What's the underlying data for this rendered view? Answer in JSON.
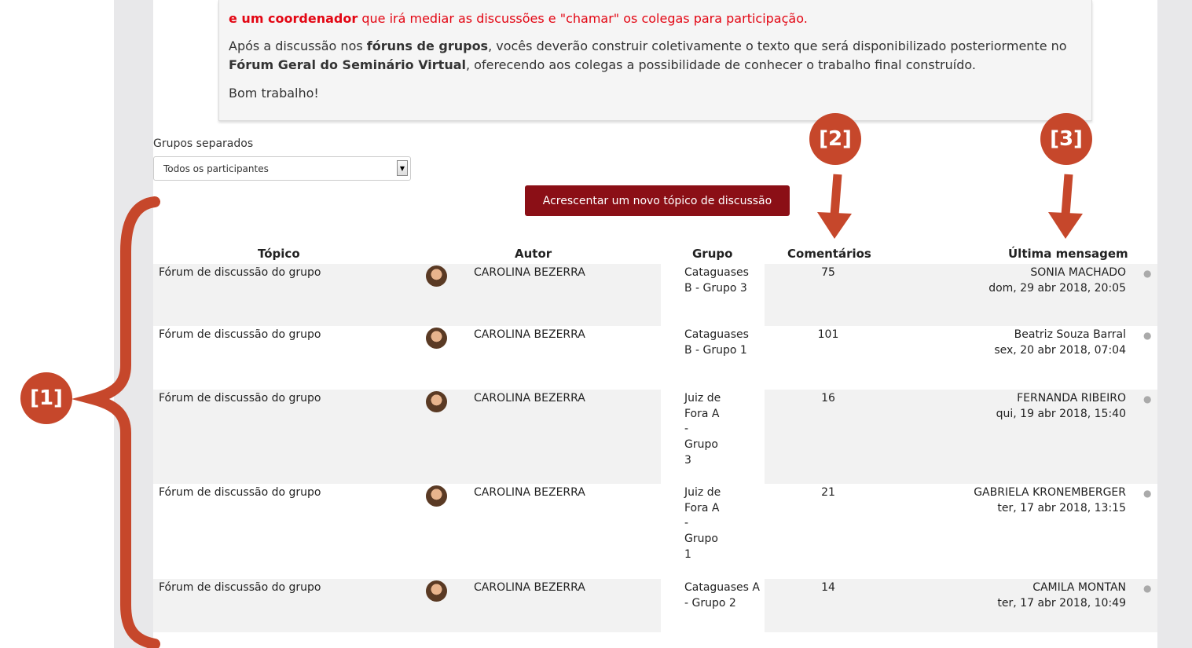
{
  "intro": {
    "line1_bold": "e um coordenador",
    "line1_rest": " que irá mediar as discussões e \"chamar\" os colegas para participação.",
    "p2_part1": "Após a discussão nos ",
    "p2_bold1": "fóruns de grupos",
    "p2_part2": ", vocês deverão construir coletivamente o texto que será disponibilizado posteriormente no ",
    "p2_bold2": "Fórum Geral do Seminário Virtual",
    "p2_part3": ", oferecendo aos colegas a possibilidade de conhecer o trabalho final construído.",
    "p3": "Bom trabalho!"
  },
  "group_filter": {
    "label": "Grupos separados",
    "selected": "Todos os participantes"
  },
  "add_topic_label": "Acrescentar um novo tópico de discussão",
  "table": {
    "headers": {
      "topic": "Tópico",
      "author": "Autor",
      "group": "Grupo",
      "comments": "Comentários",
      "last": "Última mensagem"
    },
    "rows": [
      {
        "topic": "Fórum de discussão do grupo",
        "author": "CAROLINA BEZERRA",
        "group": "Cataguases B - Grupo 3",
        "comments": "75",
        "last_user": "SONIA MACHADO",
        "last_date": "dom, 29 abr 2018, 20:05"
      },
      {
        "topic": "Fórum de discussão do grupo",
        "author": "CAROLINA BEZERRA",
        "group": "Cataguases B - Grupo 1",
        "comments": "101",
        "last_user": "Beatriz Souza Barral",
        "last_date": "sex, 20 abr 2018, 07:04"
      },
      {
        "topic": "Fórum de discussão do grupo",
        "author": "CAROLINA BEZERRA",
        "group": "Juiz de Fora A - Grupo 3",
        "comments": "16",
        "last_user": "FERNANDA RIBEIRO",
        "last_date": "qui, 19 abr 2018, 15:40"
      },
      {
        "topic": "Fórum de discussão do grupo",
        "author": "CAROLINA BEZERRA",
        "group": "Juiz de Fora A - Grupo 1",
        "comments": "21",
        "last_user": "GABRIELA KRONEMBERGER",
        "last_date": "ter, 17 abr 2018, 13:15"
      },
      {
        "topic": "Fórum de discussão do grupo",
        "author": "CAROLINA BEZERRA",
        "group": "Cataguases A - Grupo 2",
        "comments": "14",
        "last_user": "CAMILA MONTAN",
        "last_date": "ter, 17 abr 2018, 10:49"
      }
    ]
  },
  "annotations": {
    "a1": "[1]",
    "a2": "[2]",
    "a3": "[3]",
    "color": "#c6472b"
  },
  "icons": {
    "avatar": "user-avatar",
    "dropdown": "chevron-down-icon",
    "row_marker": "dot-icon"
  }
}
